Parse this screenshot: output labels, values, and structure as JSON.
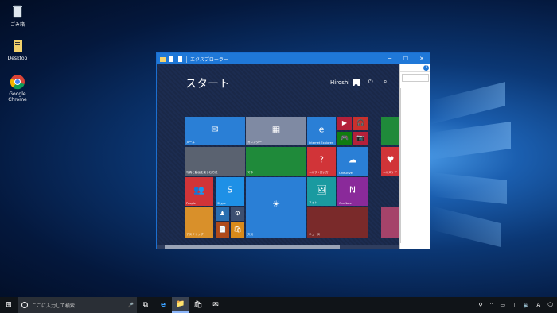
{
  "desktop": {
    "icons": [
      {
        "label": "ごみ箱",
        "icon": "recycle-bin-icon"
      },
      {
        "label": "Desktop",
        "icon": "file-icon"
      },
      {
        "label": "Google Chrome",
        "icon": "chrome-icon"
      }
    ]
  },
  "window": {
    "title": "エクスプローラー",
    "controls": {
      "minimize": "─",
      "maximize": "☐",
      "close": "✕"
    },
    "explorer_help": "?"
  },
  "start_screen": {
    "title": "スタート",
    "user_name": "Hiroshi",
    "power_glyph": "⏻",
    "search_glyph": "⌕",
    "tiles": [
      {
        "label": "メール",
        "glyph": "✉",
        "color": "#2a7fd6"
      },
      {
        "label": "カレンダー",
        "glyph": "▦",
        "color": "#7f8aa3"
      },
      {
        "label": "Internet Explorer",
        "glyph": "e",
        "color": "#2a7fd6"
      },
      {
        "label": "",
        "glyph": "▶",
        "color": "#b4203a"
      },
      {
        "label": "",
        "glyph": "🎧",
        "color": "#c9302c"
      },
      {
        "label": "",
        "glyph": "🎮",
        "color": "#107c10"
      },
      {
        "label": "",
        "glyph": "📷",
        "color": "#b4203a"
      },
      {
        "label": "写真と動画を楽しむ方法",
        "glyph": "",
        "color": "#5a6270"
      },
      {
        "label": "マネー",
        "glyph": "",
        "color": "#1f8a3a"
      },
      {
        "label": "ヘルプ+使い方",
        "glyph": "?",
        "color": "#d13438"
      },
      {
        "label": "OneDrive",
        "glyph": "☁",
        "color": "#2a7fd6"
      },
      {
        "label": "People",
        "glyph": "👥",
        "color": "#d13438"
      },
      {
        "label": "Skype",
        "glyph": "S",
        "color": "#1e90e6"
      },
      {
        "label": "天気",
        "glyph": "☀",
        "color": "#2a7fd6"
      },
      {
        "label": "フォト",
        "glyph": "🖼",
        "color": "#1a9aa0"
      },
      {
        "label": "OneNote",
        "glyph": "N",
        "color": "#8a2a9a"
      },
      {
        "label": "デスクトップ",
        "glyph": "",
        "color": "#d9902a"
      },
      {
        "label": "",
        "glyph": "♟",
        "color": "#2a6fb0"
      },
      {
        "label": "",
        "glyph": "⚙",
        "color": "#3d4f70"
      },
      {
        "label": "",
        "glyph": "📄",
        "color": "#b04a1a"
      },
      {
        "label": "",
        "glyph": "🛍",
        "color": "#d98a1a"
      },
      {
        "label": "ニュース",
        "glyph": "",
        "color": "#7a2a2a"
      },
      {
        "label": "ヘルスケア",
        "glyph": "♥",
        "color": "#d13438"
      },
      {
        "label": "",
        "glyph": "",
        "color": "#1f8a3a"
      },
      {
        "label": "",
        "glyph": "",
        "color": "#a5436a"
      }
    ]
  },
  "taskbar": {
    "start_glyph": "⊞",
    "search_placeholder": "ここに入力して検索",
    "mic_glyph": "🎤",
    "apps": [
      {
        "name": "task-view",
        "glyph": "⧉"
      },
      {
        "name": "edge",
        "glyph": "e"
      },
      {
        "name": "explorer",
        "glyph": "📁"
      },
      {
        "name": "store",
        "glyph": "🛍"
      },
      {
        "name": "mail",
        "glyph": "✉"
      }
    ],
    "tray": {
      "ime": "A",
      "notify": "🗨"
    }
  }
}
